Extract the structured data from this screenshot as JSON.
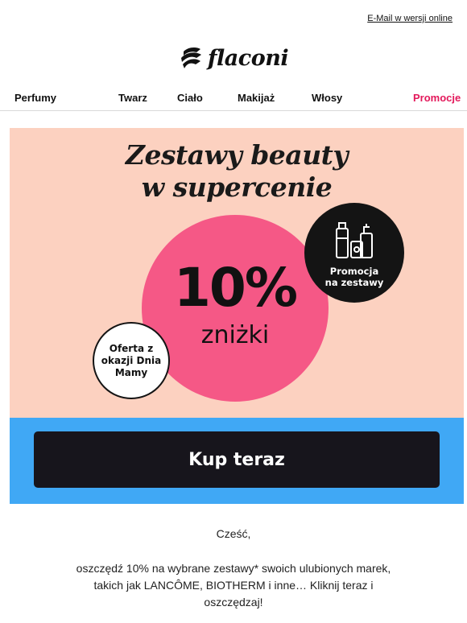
{
  "header": {
    "online_link": "E-Mail w wersji online"
  },
  "logo": {
    "text": "flaconi",
    "icon": "flaconi-brush-logo-icon"
  },
  "nav": {
    "items": [
      {
        "label": "Perfumy"
      },
      {
        "label": "Twarz"
      },
      {
        "label": "Ciało"
      },
      {
        "label": "Makijaż"
      },
      {
        "label": "Włosy"
      },
      {
        "label": "Promocje"
      }
    ],
    "promo_color": "#e3195b"
  },
  "hero": {
    "title_line1": "Zestawy beauty",
    "title_line2": "w supercenie",
    "discount": "10%",
    "discount_label": "zniżki",
    "black_badge": {
      "icon": "cosmetics-bottles-icon",
      "line1": "Promocja",
      "line2": "na zestawy"
    },
    "white_badge": {
      "line1": "Oferta z",
      "line2": "okazji Dnia",
      "line3": "Mamy"
    },
    "colors": {
      "background": "#fcd1c0",
      "circle": "#f55886",
      "badge_dark": "#141414"
    }
  },
  "cta": {
    "label": "Kup teraz",
    "band_color": "#40a8f5",
    "button_color": "#17151c"
  },
  "content": {
    "greeting": "Cześć,",
    "paragraph_line1": "oszczędź 10% na wybrane zestawy* swoich ulubionych marek,",
    "paragraph_line2": "takich jak LANCÔME, BIOTHERM i inne… Kliknij teraz i",
    "paragraph_line3": "oszczędzaj!"
  }
}
